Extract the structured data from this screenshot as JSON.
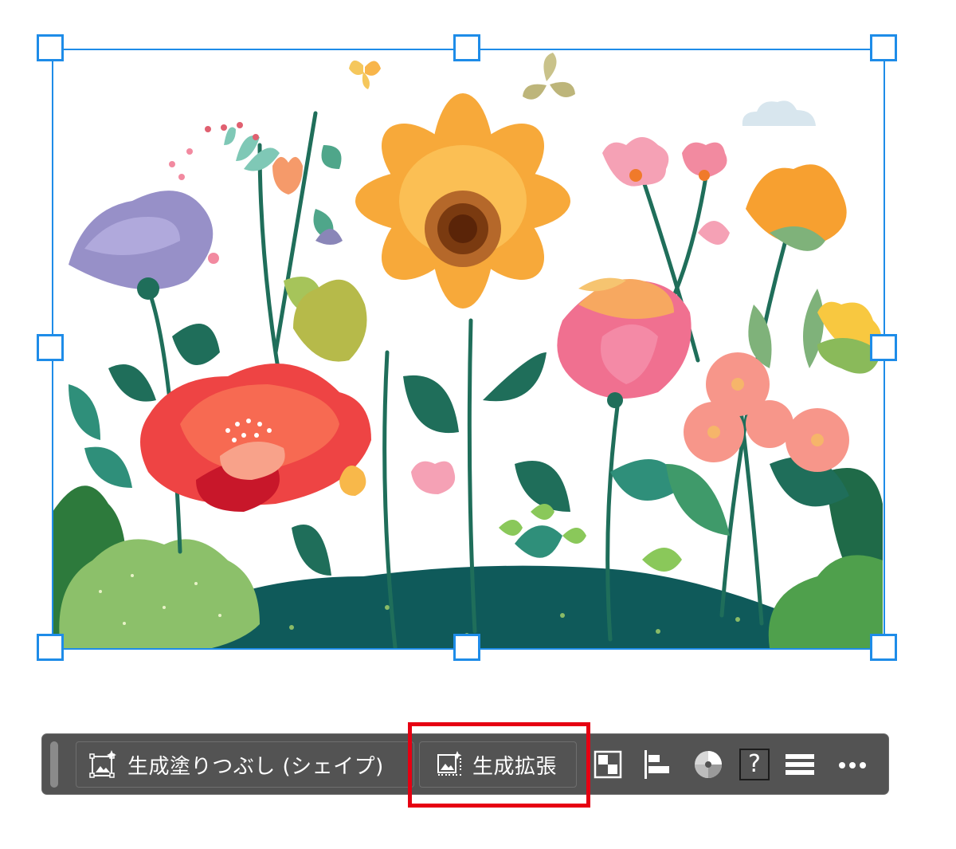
{
  "canvas": {
    "artwork_name": "flower-garden-illustration",
    "selection_color": "#1e8ce8"
  },
  "taskbar": {
    "background_color": "#535353",
    "generative_fill_label": "生成塗りつぶし (シェイプ)",
    "generative_expand_label": "生成拡張",
    "tools": [
      {
        "icon": "arrange-icon"
      },
      {
        "icon": "align-left-icon"
      },
      {
        "icon": "color-wheel-icon"
      },
      {
        "icon": "help-icon",
        "glyph": "?"
      },
      {
        "icon": "properties-menu-icon"
      },
      {
        "icon": "more-options-icon"
      }
    ]
  },
  "annotation": {
    "highlight_color": "#e60012",
    "highlighted_item": "生成拡張"
  }
}
